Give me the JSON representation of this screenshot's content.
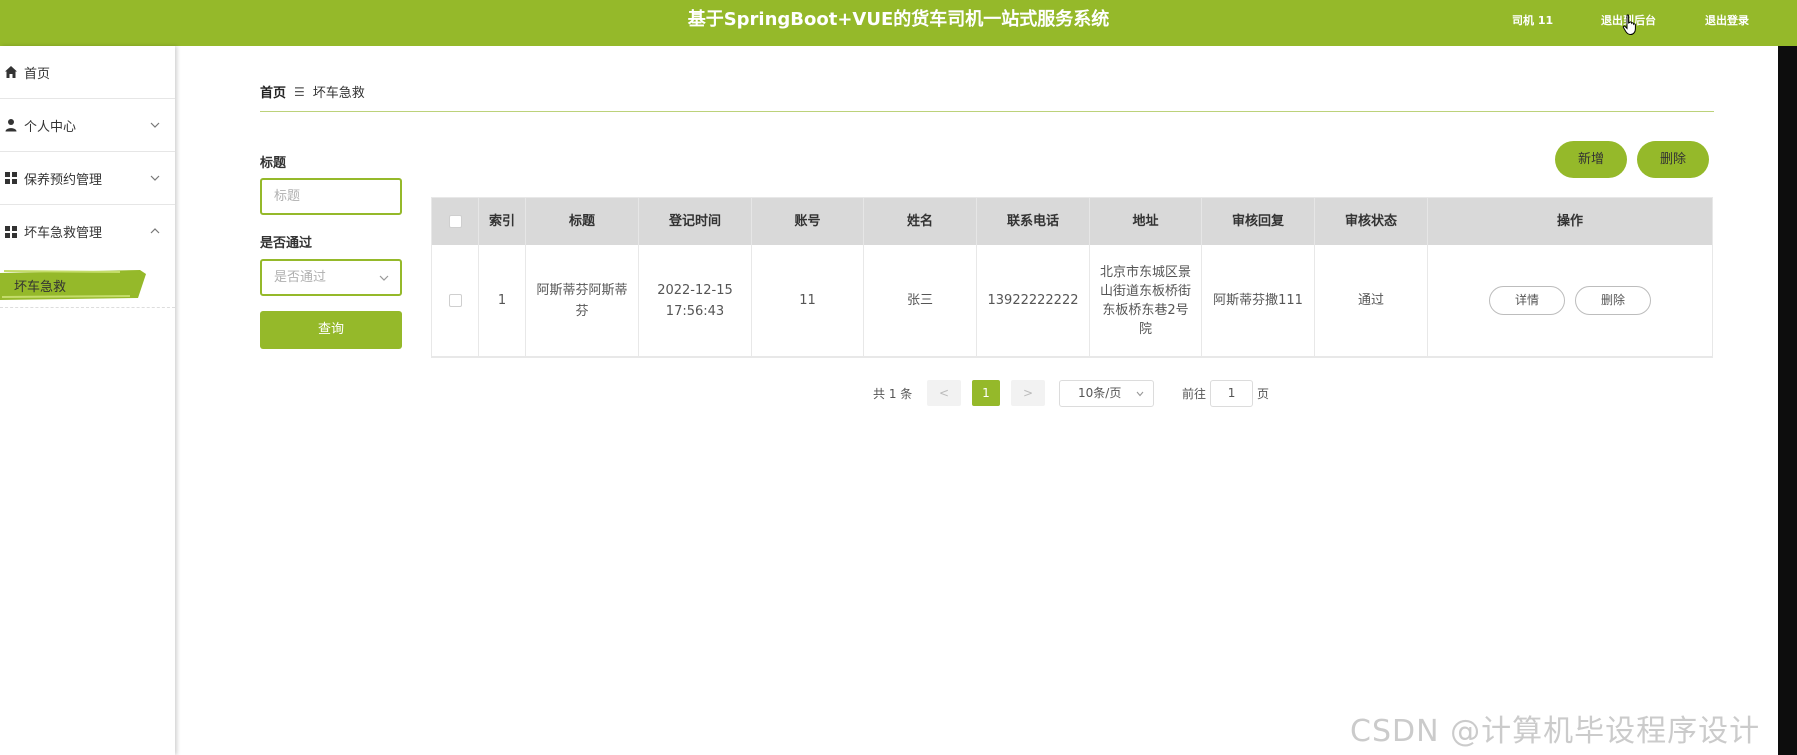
{
  "header": {
    "title": "基于SpringBoot+VUE的货车司机一站式服务系统",
    "user": "司机 11",
    "backend_link": "退出到后台",
    "logout_link": "退出登录",
    "bg_color": "#95b92a"
  },
  "sidebar": {
    "items": [
      {
        "label": "首页",
        "icon": "home-icon"
      },
      {
        "label": "个人中心",
        "icon": "user-icon",
        "chevron": "chevron-down-icon"
      },
      {
        "label": "保养预约管理",
        "icon": "grid-icon",
        "chevron": "chevron-down-icon"
      },
      {
        "label": "坏车急救管理",
        "icon": "grid-icon",
        "chevron": "chevron-up-icon"
      }
    ],
    "subitem": "坏车急救"
  },
  "breadcrumb": {
    "home": "首页",
    "separator": "☰",
    "current": "坏车急救"
  },
  "filters": {
    "title_label": "标题",
    "title_placeholder": "标题",
    "pass_label": "是否通过",
    "pass_placeholder": "是否通过",
    "query_button": "查询"
  },
  "actions": {
    "add": "新增",
    "delete": "删除"
  },
  "table": {
    "headers": [
      "索引",
      "标题",
      "登记时间",
      "账号",
      "姓名",
      "联系电话",
      "地址",
      "审核回复",
      "审核状态",
      "操作"
    ],
    "rows": [
      {
        "index": "1",
        "title": "阿斯蒂芬阿斯蒂芬",
        "time": "2022-12-15 17:56:43",
        "account": "11",
        "name": "张三",
        "phone": "13922222222",
        "address": "北京市东城区景山街道东板桥街东板桥东巷2号院",
        "reply": "阿斯蒂芬撒111",
        "status": "通过",
        "detail_btn": "详情",
        "delete_btn": "删除"
      }
    ]
  },
  "pagination": {
    "total": "共 1 条",
    "prev": "<",
    "current_page": "1",
    "next": ">",
    "page_size": "10条/页",
    "goto_prefix": "前往",
    "goto_value": "1",
    "goto_suffix": "页"
  },
  "watermark": "CSDN @计算机毕设程序设计"
}
